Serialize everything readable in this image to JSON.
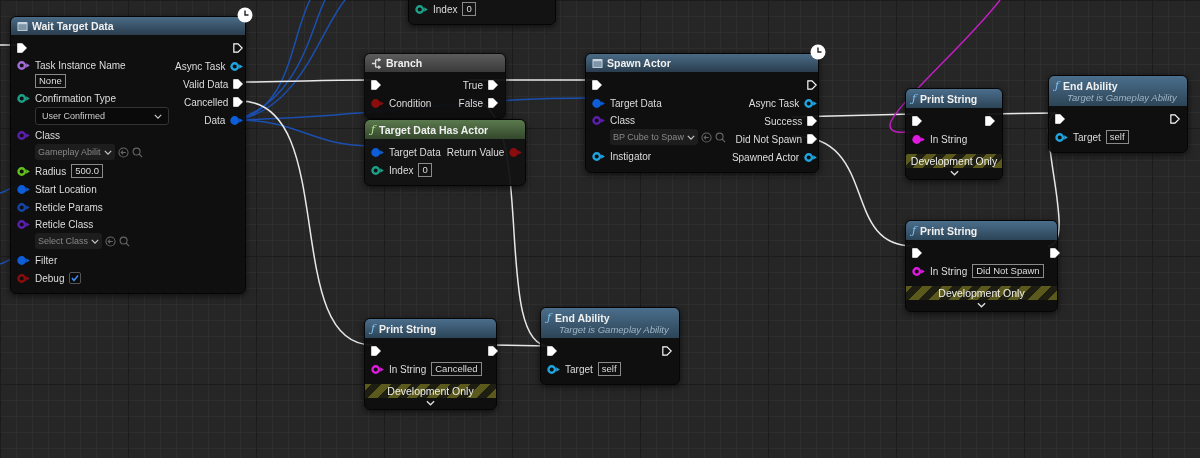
{
  "nodes": [
    {
      "kind": "latent",
      "title": "Wait Target Data",
      "latent": true,
      "left": [
        {
          "kind": "exec",
          "connected": true
        },
        {
          "kind": "stacked",
          "label": "Task Instance Name",
          "color": "#a46cd9",
          "connected": false,
          "widget": {
            "kind": "text",
            "value": "None"
          }
        },
        {
          "kind": "stacked",
          "label": "Confirmation Type",
          "color": "#1ba289",
          "connected": false,
          "widget": {
            "kind": "dropdown",
            "value": "User Confirmed"
          }
        },
        {
          "kind": "stacked",
          "label": "Class",
          "color": "#5c1fb0",
          "connected": false,
          "widget": {
            "kind": "class",
            "value": "Gameplay Abilit"
          }
        },
        {
          "kind": "data",
          "label": "Radius",
          "color": "#62c11d",
          "connected": false,
          "widget": {
            "kind": "text",
            "value": "500.0"
          }
        },
        {
          "kind": "data",
          "label": "Start Location",
          "color": "#0d5ed8",
          "connected": true
        },
        {
          "kind": "data",
          "label": "Reticle Params",
          "color": "#1647a8",
          "connected": false
        },
        {
          "kind": "stacked",
          "label": "Reticle Class",
          "color": "#5c1fb0",
          "connected": false,
          "widget": {
            "kind": "class",
            "value": "Select Class"
          }
        },
        {
          "kind": "data",
          "label": "Filter",
          "color": "#0d5ed8",
          "connected": true
        },
        {
          "kind": "data",
          "label": "Debug",
          "color": "#8b0d0d",
          "connected": false,
          "widget": {
            "kind": "checkbox",
            "checked": true
          }
        }
      ],
      "right": [
        {
          "kind": "exec",
          "connected": false
        },
        {
          "kind": "data",
          "label": "Async Task",
          "color": "#1fa5e0",
          "connected": false
        },
        {
          "kind": "exec",
          "label": "Valid Data",
          "connected": true
        },
        {
          "kind": "exec",
          "label": "Cancelled",
          "connected": true
        },
        {
          "kind": "data",
          "label": "Data",
          "color": "#0d5ed8",
          "connected": true
        }
      ]
    },
    {
      "kind": "pure",
      "left": [
        {
          "kind": "data",
          "label": "Index",
          "color": "#1ba289",
          "connected": false,
          "widget": {
            "kind": "text",
            "value": "0"
          }
        }
      ]
    },
    {
      "kind": "branch",
      "title": "Branch",
      "left": [
        {
          "kind": "exec",
          "connected": true
        },
        {
          "kind": "data",
          "label": "Condition",
          "color": "#8b0d0d",
          "connected": true
        }
      ],
      "right": [
        {
          "kind": "exec",
          "label": "True",
          "connected": true
        },
        {
          "kind": "exec",
          "label": "False",
          "connected": true
        }
      ]
    },
    {
      "kind": "pure",
      "title": "Target Data Has Actor",
      "icon": "ƒ",
      "left": [
        {
          "kind": "data",
          "label": "Target Data",
          "color": "#0d5ed8",
          "connected": true
        },
        {
          "kind": "data",
          "label": "Index",
          "color": "#1ba289",
          "connected": false,
          "widget": {
            "kind": "text",
            "value": "0"
          }
        }
      ],
      "right": [
        {
          "kind": "data",
          "label": "Return Value",
          "color": "#8b0d0d",
          "connected": true
        }
      ]
    },
    {
      "kind": "latent",
      "title": "Spawn Actor",
      "latent": true,
      "left": [
        {
          "kind": "exec",
          "connected": true
        },
        {
          "kind": "data",
          "label": "Target Data",
          "color": "#0d5ed8",
          "connected": true
        },
        {
          "kind": "stacked",
          "label": "Class",
          "color": "#5c1fb0",
          "connected": false,
          "widget": {
            "kind": "class",
            "value": "BP Cube to Spaw"
          }
        },
        {
          "kind": "data",
          "label": "Instigator",
          "color": "#1fa5e0",
          "connected": false
        }
      ],
      "right": [
        {
          "kind": "exec",
          "connected": false
        },
        {
          "kind": "data",
          "label": "Async Task",
          "color": "#1fa5e0",
          "connected": false
        },
        {
          "kind": "exec",
          "label": "Success",
          "connected": true
        },
        {
          "kind": "exec",
          "label": "Did Not Spawn",
          "connected": true
        },
        {
          "kind": "data",
          "label": "Spawned Actor",
          "color": "#1fa5e0",
          "connected": false
        }
      ]
    },
    {
      "kind": "function",
      "title": "Print String",
      "icon": "ƒ",
      "banner": "Development Only",
      "left": [
        {
          "kind": "exec",
          "connected": true
        },
        {
          "kind": "data",
          "label": "In String",
          "color": "#e01be0",
          "connected": true
        }
      ],
      "right": [
        {
          "kind": "exec",
          "connected": true
        }
      ]
    },
    {
      "kind": "function",
      "title": "End Ability",
      "icon": "ƒ",
      "subtitle": "Target is Gameplay Ability",
      "left": [
        {
          "kind": "exec",
          "connected": true
        },
        {
          "kind": "data",
          "label": "Target",
          "color": "#1fa5e0",
          "connected": false,
          "widget": {
            "kind": "text",
            "value": "self"
          }
        }
      ],
      "right": [
        {
          "kind": "exec",
          "connected": false
        }
      ]
    },
    {
      "kind": "function",
      "title": "Print String",
      "icon": "ƒ",
      "banner": "Development Only",
      "left": [
        {
          "kind": "exec",
          "connected": true
        },
        {
          "kind": "data",
          "label": "In String",
          "color": "#e01be0",
          "connected": false,
          "widget": {
            "kind": "text",
            "value": "Did Not Spawn"
          }
        }
      ],
      "right": [
        {
          "kind": "exec",
          "connected": true
        }
      ]
    },
    {
      "kind": "function",
      "title": "Print String",
      "icon": "ƒ",
      "banner": "Development Only",
      "left": [
        {
          "kind": "exec",
          "connected": true
        },
        {
          "kind": "data",
          "label": "In String",
          "color": "#e01be0",
          "connected": false,
          "widget": {
            "kind": "text",
            "value": "Cancelled"
          }
        }
      ],
      "right": [
        {
          "kind": "exec",
          "connected": true
        }
      ]
    },
    {
      "kind": "function",
      "title": "End Ability",
      "icon": "ƒ",
      "subtitle": "Target is Gameplay Ability",
      "left": [
        {
          "kind": "exec",
          "connected": true
        },
        {
          "kind": "data",
          "label": "Target",
          "color": "#1fa5e0",
          "connected": false,
          "widget": {
            "kind": "text",
            "value": "self"
          }
        }
      ],
      "right": [
        {
          "kind": "exec",
          "connected": false
        }
      ]
    }
  ]
}
